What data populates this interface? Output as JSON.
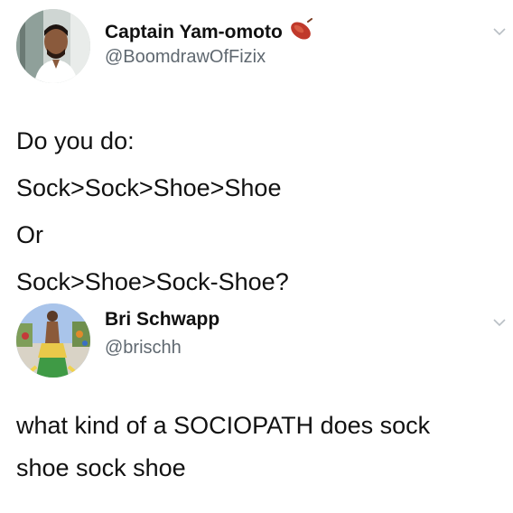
{
  "tweets": [
    {
      "name": "Captain Yam-omoto",
      "name_emoji": "sweet-potato-icon",
      "handle": "@BoomdrawOfFizix",
      "lines": [
        "Do you do:",
        "Sock>Sock>Shoe>Shoe",
        "Or",
        "Sock>Shoe>Sock-Shoe?"
      ]
    },
    {
      "name": "Bri Schwapp",
      "handle": "@brischh",
      "lines": [
        "what kind of a SOCIOPATH does sock",
        "shoe sock shoe"
      ]
    }
  ],
  "colors": {
    "text": "#111111",
    "handle": "#5f6870",
    "chevron": "#b8bec4",
    "sweet_potato": "#c0392b"
  }
}
